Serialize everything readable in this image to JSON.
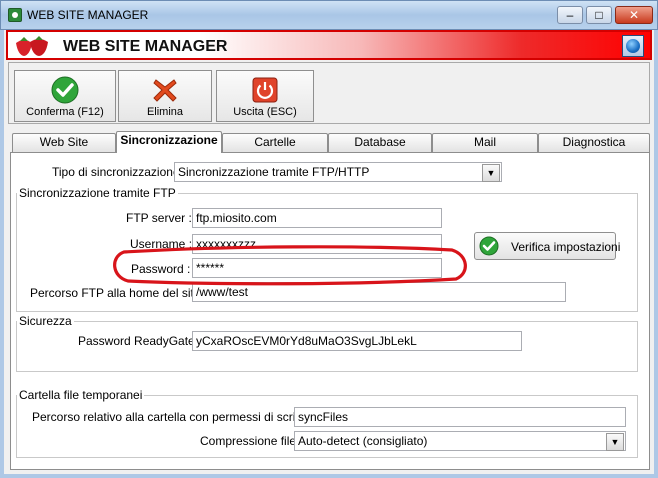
{
  "window": {
    "title": "WEB SITE MANAGER",
    "controls": [
      "minimize",
      "maximize",
      "close"
    ]
  },
  "banner": {
    "title": "WEB SITE MANAGER",
    "logo": "strawberries",
    "icon": "globe-icon"
  },
  "toolbar": {
    "confirm_label": "Conferma (F12)",
    "delete_label": "Elimina",
    "exit_label": "Uscita (ESC)"
  },
  "tabs": [
    {
      "label": "Web Site"
    },
    {
      "label": "Sincronizzazione"
    },
    {
      "label": "Cartelle"
    },
    {
      "label": "Database"
    },
    {
      "label": "Mail"
    },
    {
      "label": "Diagnostica"
    }
  ],
  "sync": {
    "type_label": "Tipo di sincronizzazione :",
    "type_value": "Sincronizzazione tramite FTP/HTTP",
    "ftp_group_label": "Sincronizzazione tramite FTP",
    "ftp_server_label": "FTP server :",
    "ftp_server_value": "ftp.miosito.com",
    "username_label": "Username :",
    "username_value": "xxxxxxxzzz",
    "password_label": "Password :",
    "password_value": "******",
    "ftp_path_label": "Percorso FTP alla home del sito :",
    "ftp_path_value": "/www/test",
    "verify_label": "Verifica impostazioni"
  },
  "security": {
    "group_label": "Sicurezza",
    "readygate_label": "Password ReadyGate :",
    "readygate_value": "yCxaROscEVM0rYd8uMaO3SvgLJbLekL"
  },
  "temp": {
    "group_label": "Cartella file temporanei",
    "path_label": "Percorso relativo alla cartella con permessi di scrittura :",
    "path_value": "syncFiles",
    "compression_label": "Compressione file :",
    "compression_value": "Auto-detect (consigliato)"
  },
  "colors": {
    "banner_accent": "#ff0000",
    "highlight_ellipse": "#d8141a"
  }
}
